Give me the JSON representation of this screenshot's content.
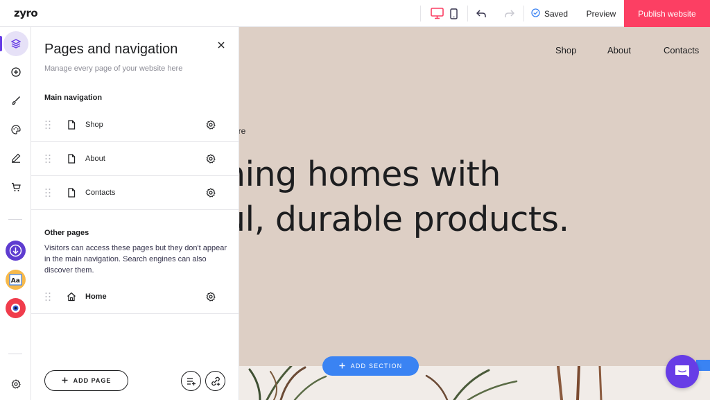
{
  "app": {
    "logo": "zyro"
  },
  "topbar": {
    "saved_label": "Saved",
    "preview_label": "Preview",
    "publish_label": "Publish website"
  },
  "panel": {
    "title": "Pages and navigation",
    "subtitle": "Manage every page of your website here",
    "main_nav_heading": "Main navigation",
    "main_nav_items": [
      {
        "label": "Shop",
        "icon": "page-icon"
      },
      {
        "label": "About",
        "icon": "page-icon"
      },
      {
        "label": "Contacts",
        "icon": "page-icon"
      }
    ],
    "other_heading": "Other pages",
    "other_description": "Visitors can access these pages but they don't appear in the main navigation. Search engines can also discover them.",
    "other_items": [
      {
        "label": "Home",
        "icon": "home-icon"
      }
    ],
    "add_page_label": "ADD PAGE"
  },
  "canvas": {
    "nav": [
      "Shop",
      "About",
      "Contacts"
    ],
    "hero_small": "are",
    "hero_line1": "ning homes with",
    "hero_line2": "ul, durable products.",
    "add_section_label": "ADD SECTION"
  },
  "colors": {
    "accent": "#673de6",
    "publish": "#fc3f63",
    "canvas_bg": "#ddcfc5",
    "add_section": "#3a83f3"
  }
}
